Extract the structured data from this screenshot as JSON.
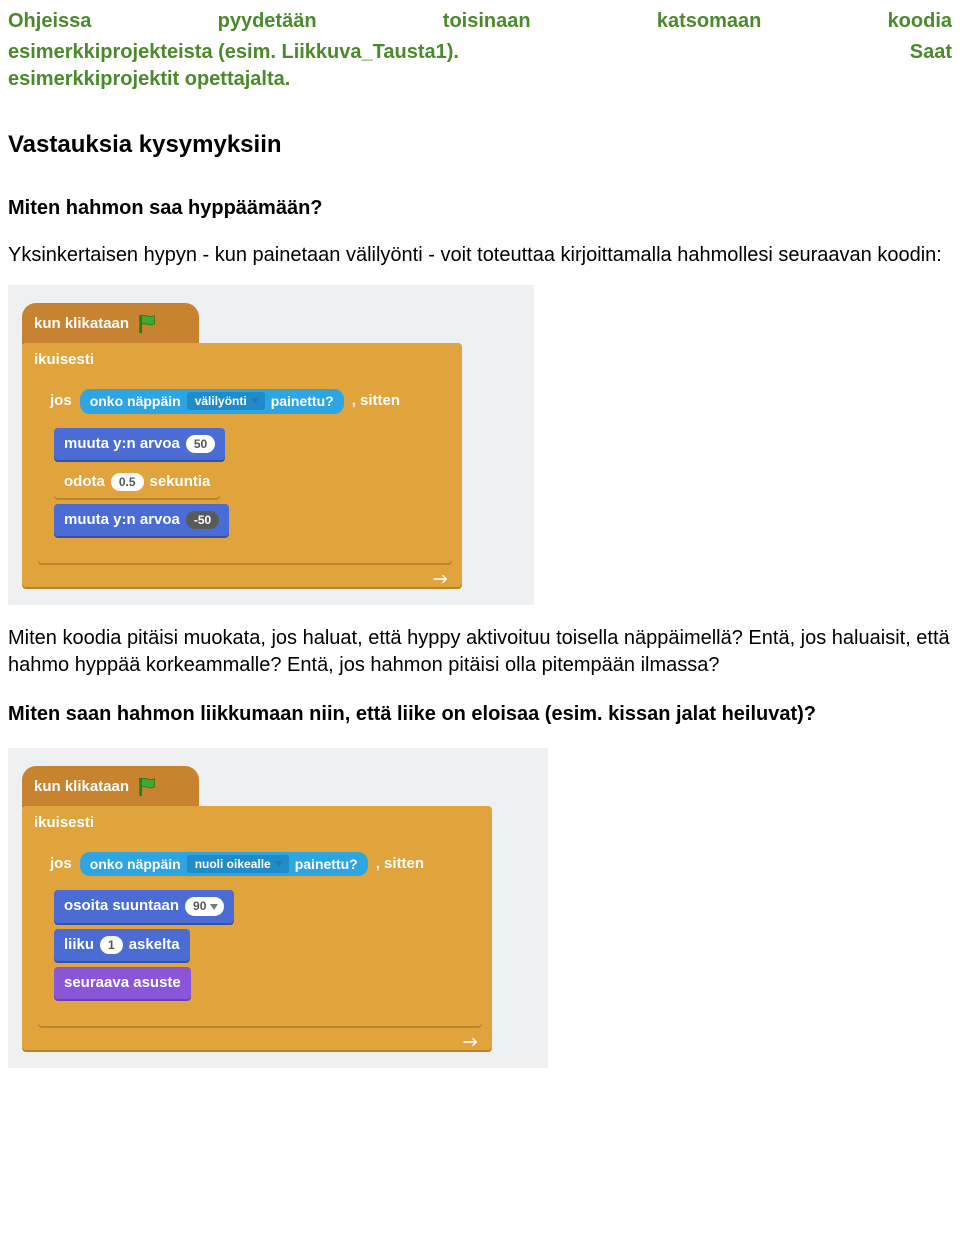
{
  "intro": {
    "line1_words": [
      "Ohjeissa",
      "pyydetään",
      "toisinaan",
      "katsomaan",
      "koodia"
    ],
    "line2_left": "esimerkkiprojekteista (esim. Liikkuva_Tausta1).",
    "line2_right": "Saat",
    "line3": "esimerkkiprojektit opettajalta."
  },
  "section1": "Vastauksia kysymyksiin",
  "q1": "Miten hahmon saa hyppäämään?",
  "p1": "Yksinkertaisen hypyn - kun painetaan välilyönti - voit toteuttaa kirjoittamalla hahmollesi seuraavan koodin:",
  "after1": "Miten koodia pitäisi muokata, jos haluat, että hyppy aktivoituu toisella näppäimellä? Entä, jos haluaisit, että hahmo hyppää korkeammalle? Entä, jos hahmon pitäisi olla pitempään ilmassa?",
  "q2": "Miten saan hahmon liikkumaan niin, että liike on eloisaa (esim. kissan jalat heiluvat)?",
  "scratch": {
    "hat": "kun klikataan",
    "forever": "ikuisesti",
    "if": "jos",
    "then": ", sitten",
    "key_pressed_pre": "onko näppäin",
    "key_pressed_post": "painettu?",
    "key_space": "välilyönti",
    "key_right": "nuoli oikealle",
    "changeY": "muuta y:n arvoa",
    "wait_pre": "odota",
    "wait_post": "sekuntia",
    "v50": "50",
    "v05": "0.5",
    "vn50": "-50",
    "point": "osoita suuntaan",
    "v90": "90",
    "move_pre": "liiku",
    "move_post": "askelta",
    "v1": "1",
    "next_costume": "seuraava asuste"
  }
}
